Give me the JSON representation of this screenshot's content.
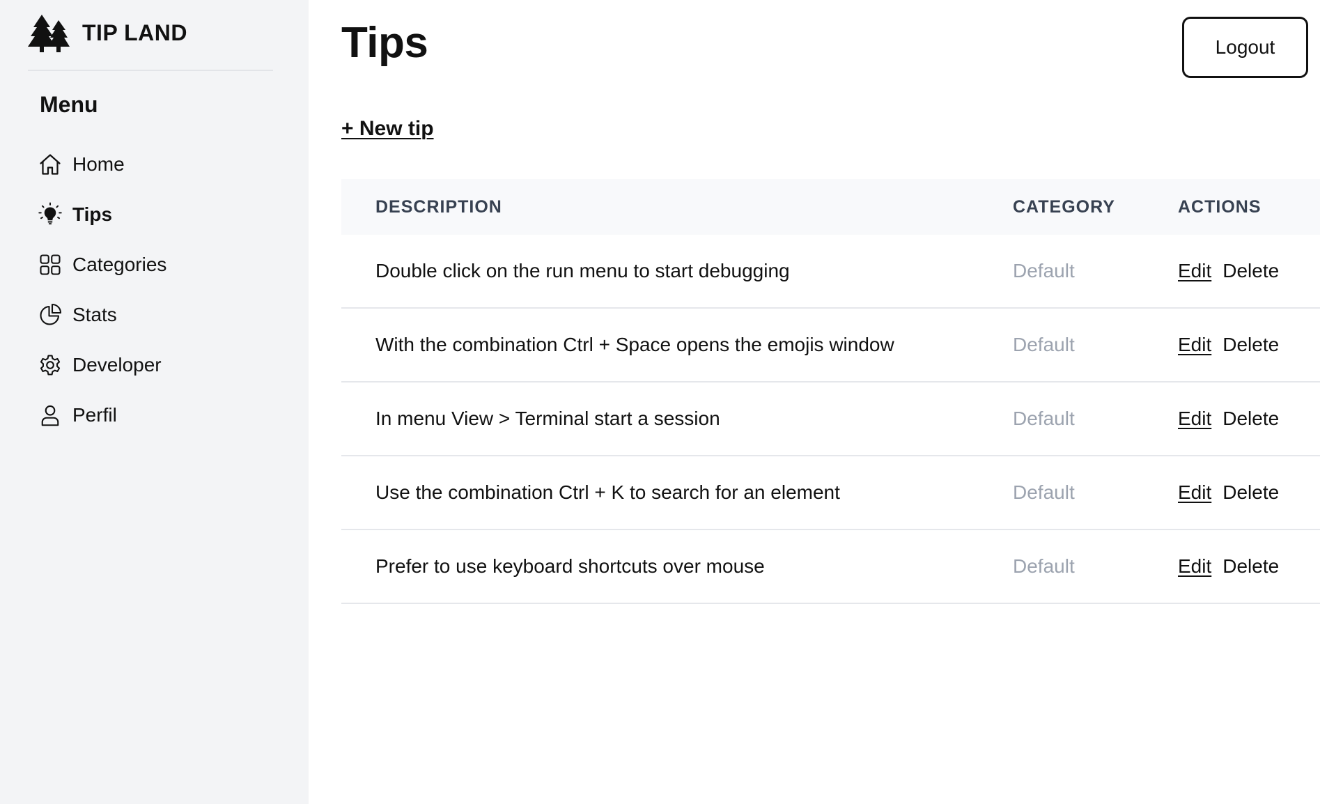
{
  "brand": {
    "name": "TIP LAND",
    "logo_icon": "pine-trees-icon"
  },
  "sidebar": {
    "menu_title": "Menu",
    "items": [
      {
        "label": "Home",
        "icon": "home-icon",
        "active": false
      },
      {
        "label": "Tips",
        "icon": "lightbulb-icon",
        "active": true
      },
      {
        "label": "Categories",
        "icon": "grid-icon",
        "active": false
      },
      {
        "label": "Stats",
        "icon": "pie-chart-icon",
        "active": false
      },
      {
        "label": "Developer",
        "icon": "gear-icon",
        "active": false
      },
      {
        "label": "Perfil",
        "icon": "user-icon",
        "active": false
      }
    ]
  },
  "header": {
    "title": "Tips",
    "logout_label": "Logout"
  },
  "actions": {
    "new_tip_label": "+ New tip"
  },
  "table": {
    "columns": [
      "DESCRIPTION",
      "CATEGORY",
      "ACTIONS"
    ],
    "edit_label": "Edit",
    "delete_label": "Delete",
    "rows": [
      {
        "description": "Double click on the run menu to start debugging",
        "category": "Default"
      },
      {
        "description": "With the combination Ctrl + Space opens the emojis window",
        "category": "Default"
      },
      {
        "description": "In menu View > Terminal start a session",
        "category": "Default"
      },
      {
        "description": "Use the combination Ctrl + K to search for an element",
        "category": "Default"
      },
      {
        "description": "Prefer to use keyboard shortcuts over mouse",
        "category": "Default"
      }
    ]
  },
  "colors": {
    "sidebar_bg": "#f3f4f6",
    "table_header_bg": "#f8f9fb",
    "muted_text": "#9ca3af",
    "text": "#111111"
  }
}
